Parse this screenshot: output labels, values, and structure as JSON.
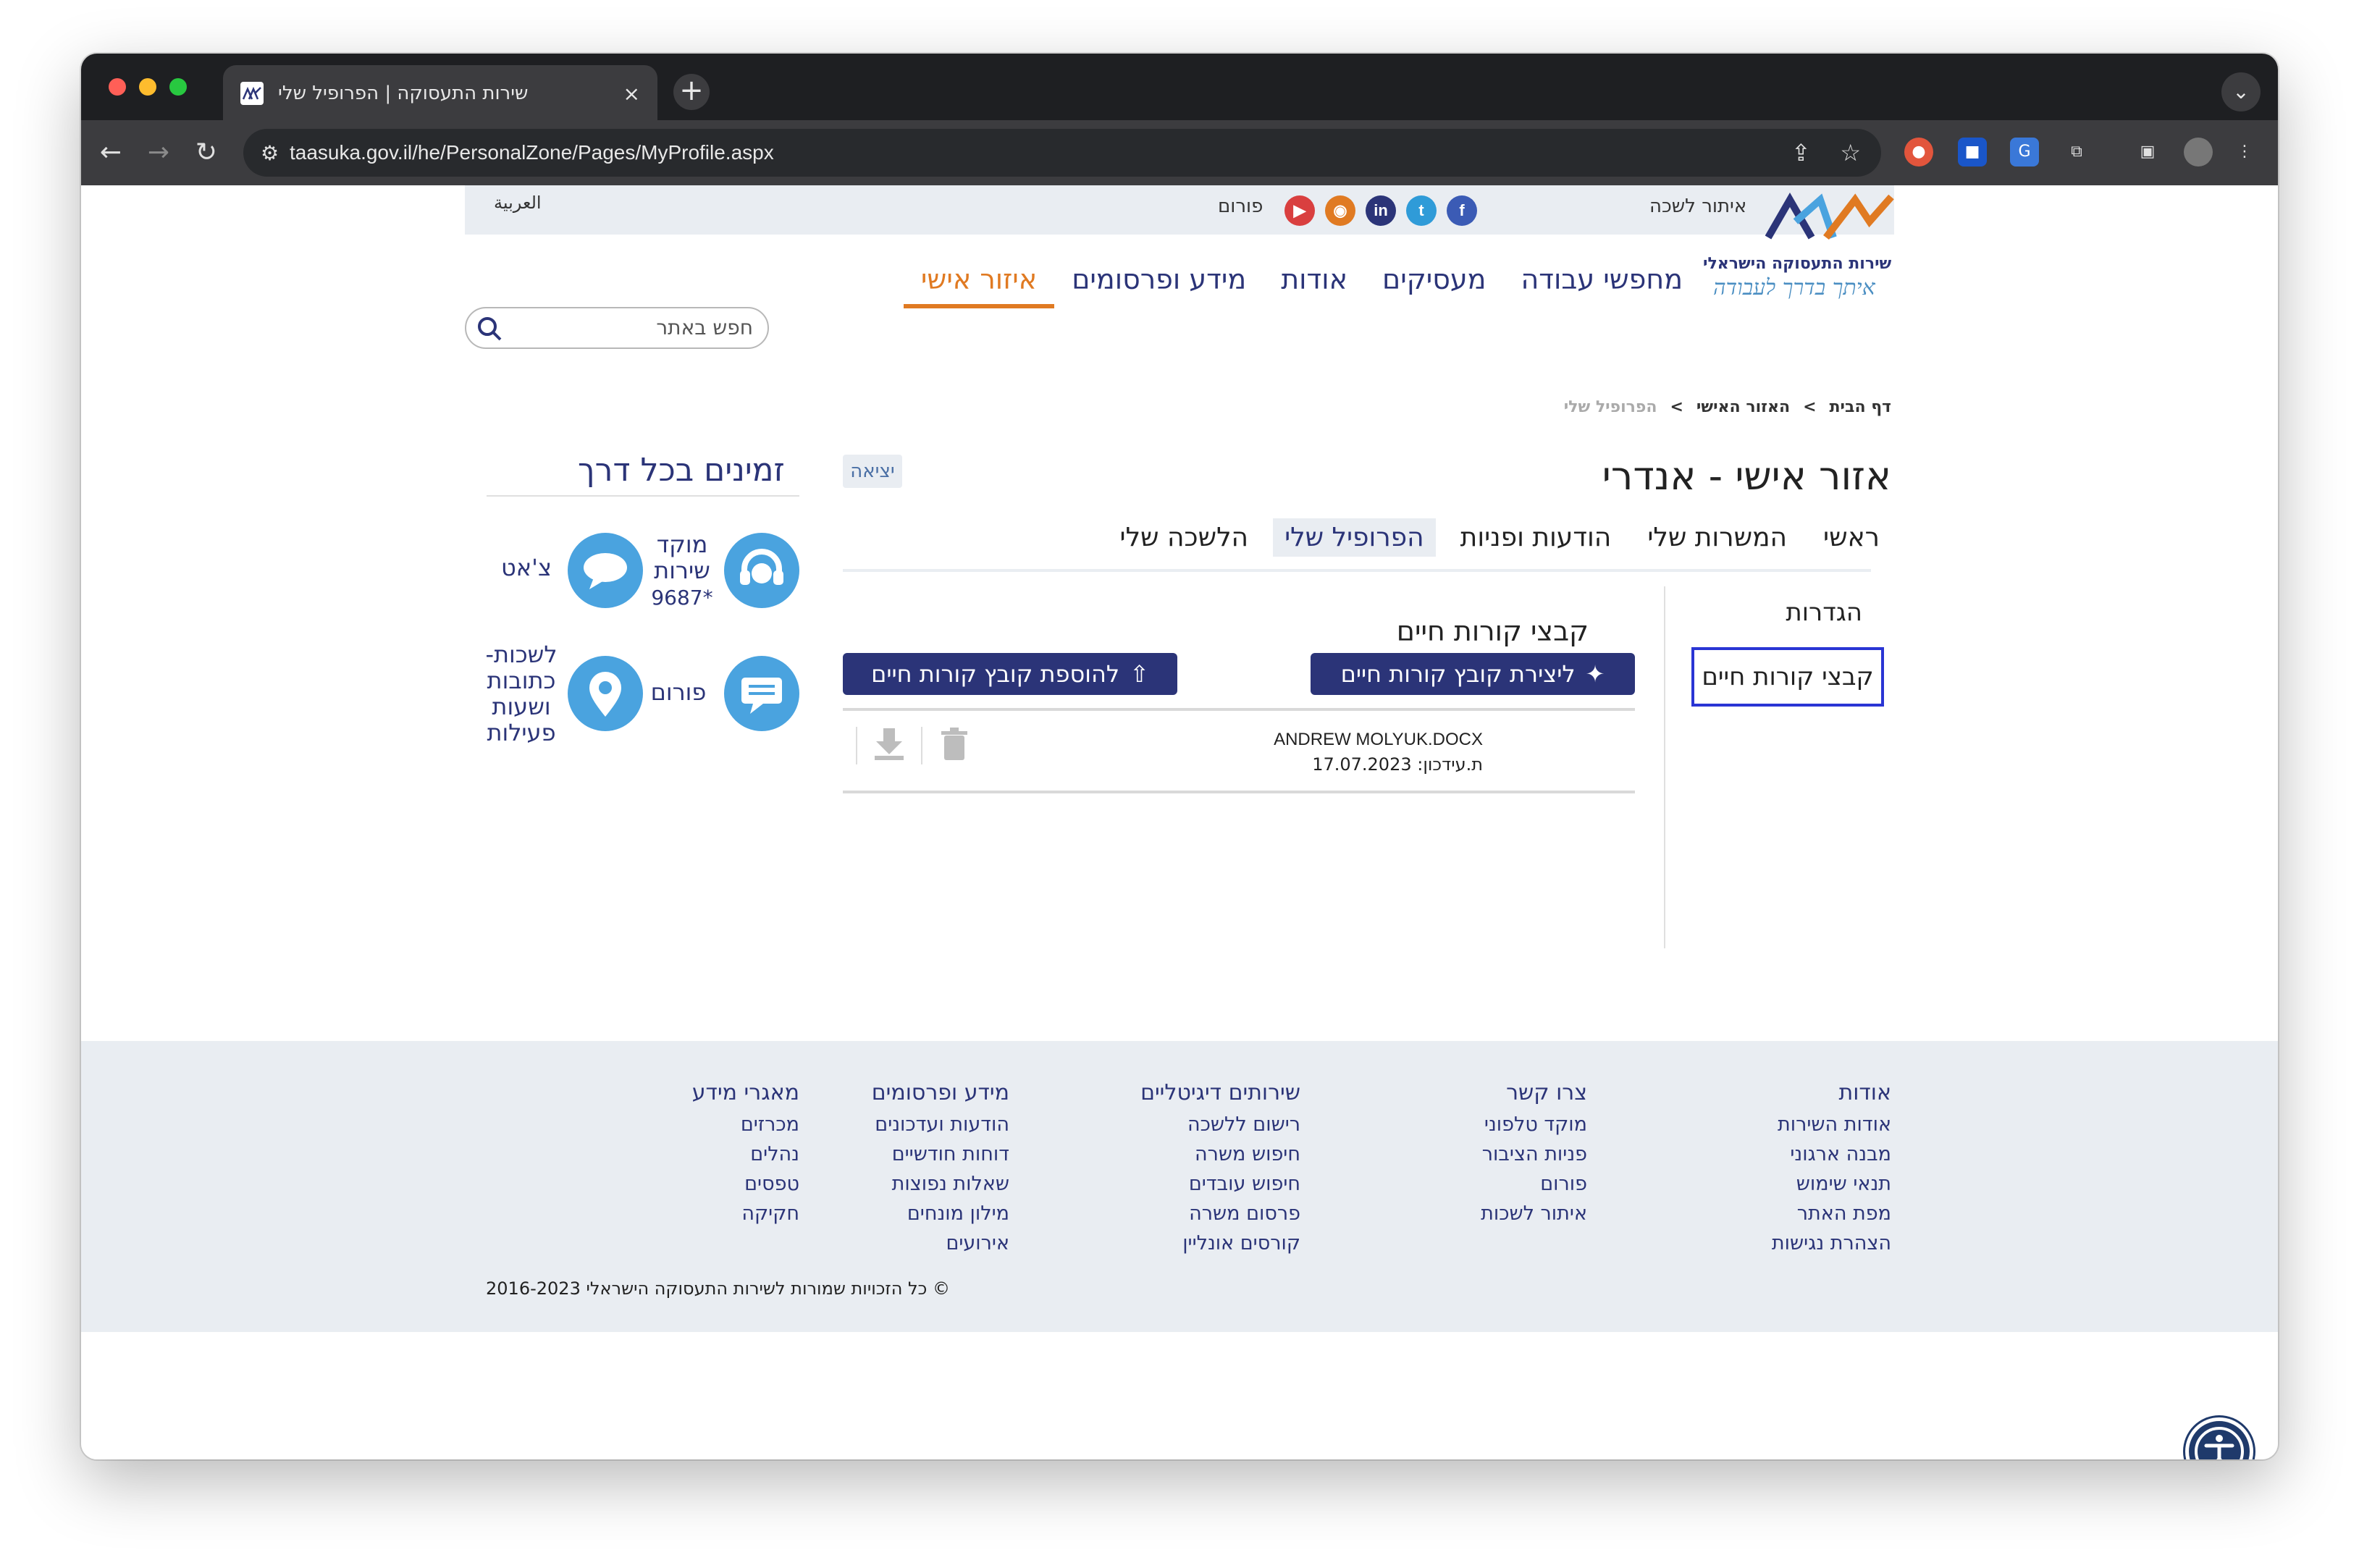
{
  "browser": {
    "tab_title": "שירות התעסוקה | הפרופיל שלי",
    "tab_close": "×",
    "new_tab": "+",
    "url": "taasuka.gov.il/he/PersonalZone/Pages/MyProfile.aspx"
  },
  "topbar": {
    "arabic_link": "العربية",
    "forum_link": "פורום",
    "branch_finder": "איתור לשכה",
    "social": [
      "youtube-icon",
      "rss-icon",
      "linkedin-icon",
      "twitter-icon",
      "facebook-icon"
    ]
  },
  "logo": {
    "line1": "שירות התעסוקה הישראלי",
    "line2": "איתך בדרך לעבודה"
  },
  "nav": {
    "items": [
      {
        "label": "מחפשי עבודה"
      },
      {
        "label": "מעסיקים"
      },
      {
        "label": "אודות"
      },
      {
        "label": "מידע ופרסומים"
      },
      {
        "label": "איזור אישי",
        "active": true
      }
    ],
    "search_placeholder": "חפש באתר"
  },
  "breadcrumb": {
    "home": "דף הבית",
    "personal": "האזור האישי",
    "current": "הפרופיל שלי",
    "separator": ">"
  },
  "page": {
    "title": "אזור אישי - אנדרי",
    "logout": "יציאה"
  },
  "subnav": {
    "items": [
      {
        "label": "ראשי"
      },
      {
        "label": "המשרות שלי"
      },
      {
        "label": "הודעות ופניות"
      },
      {
        "label": "הפרופיל שלי",
        "active": true
      },
      {
        "label": "הלשכה שלי"
      }
    ]
  },
  "settings": {
    "heading": "הגדרות",
    "selected_item": "קבצי קורות חיים"
  },
  "cv": {
    "title": "קבצי קורות חיים",
    "create_button": "ליצירת קובץ קורות חיים",
    "add_button": "להוספת קובץ קורות חיים",
    "file_name": "ANDREW MOLYUK.DOCX",
    "file_date": "ת.עידכון: 17.07.2023"
  },
  "sidebar": {
    "title": "זמינים בכל דרך",
    "service_center": "מוקד שירות",
    "service_number": "*9687",
    "chat": "צ'אט",
    "forum": "פורום",
    "branches": "לשכות- כתובות ושעות פעילות"
  },
  "footer": {
    "columns": [
      {
        "heading": "אודות",
        "links": [
          "אודות השירות",
          "מבנה ארגוני",
          "תנאי שימוש",
          "מפת האתר",
          "הצהרת נגישות"
        ]
      },
      {
        "heading": "צרו קשר",
        "links": [
          "מוקד טלפוני",
          "פניות הציבור",
          "פורום",
          "איתור לשכות"
        ]
      },
      {
        "heading": "שירותים דיגיטליים",
        "links": [
          "רישום ללשכה",
          "חיפוש משרה",
          "חיפוש עובדים",
          "פרסום משרה",
          "קורסים אונליין"
        ]
      },
      {
        "heading": "מידע ופרסומים",
        "links": [
          "הודעות ועדכונים",
          "דוחות חודשיים",
          "שאלות נפוצות",
          "מילון מונחים",
          "אירועים"
        ]
      },
      {
        "heading": "מאגרי מידע",
        "links": [
          "מכרזים",
          "נהלים",
          "טפסים",
          "חקיקה"
        ]
      }
    ],
    "copyright": "© כל הזכויות שמורות לשירות התעסוקה הישראלי 2016-2023"
  },
  "colors": {
    "brand_navy": "#2b3478",
    "accent_orange": "#e07a22",
    "light_bg": "#e9edf2",
    "focus_blue": "#2a35d4",
    "icon_blue": "#4aa3df"
  }
}
